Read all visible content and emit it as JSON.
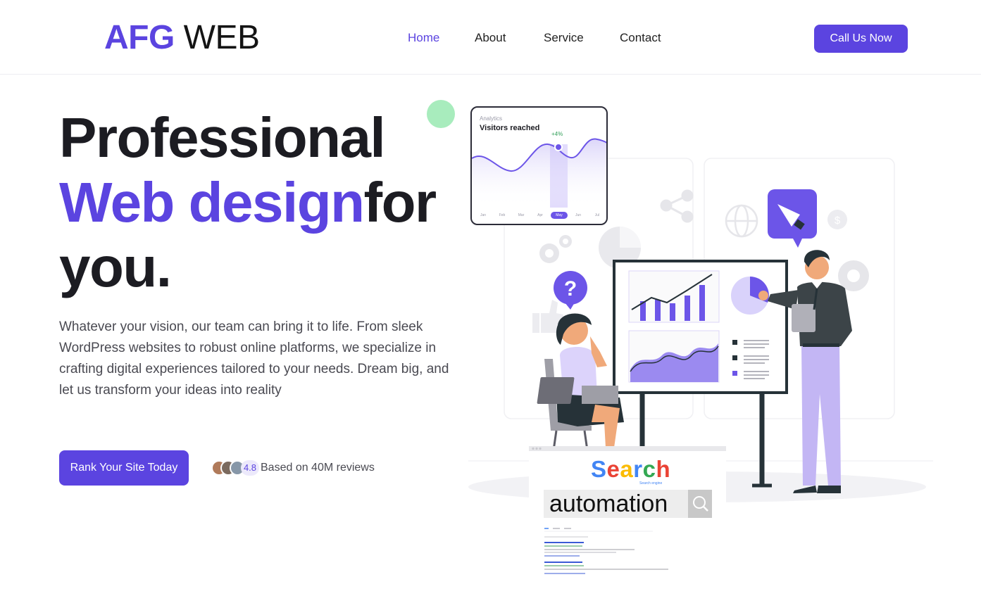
{
  "header": {
    "logo_bold": "AFG",
    "logo_light": "WEB",
    "nav": [
      {
        "label": "Home",
        "active": true
      },
      {
        "label": "About",
        "active": false
      },
      {
        "label": "Service",
        "active": false
      },
      {
        "label": "Contact",
        "active": false
      }
    ],
    "cta_label": "Call Us Now"
  },
  "hero": {
    "title_line1": "Professional",
    "title_accent": "Web design",
    "title_rest": "for",
    "title_line3": "you.",
    "description": "Whatever your vision, our team can bring it to life. From sleek WordPress websites to robust online platforms, we specialize in crafting digital experiences tailored to your needs. Dream big, and let us transform your ideas into reality",
    "button_label": "Rank Your Site Today",
    "rating": "4.8",
    "reviews_text": "Based on 40M reviews"
  },
  "analytics_card": {
    "subtitle": "Analytics",
    "title": "Visitors reached",
    "badge": "+4%",
    "months": [
      "Jan",
      "Feb",
      "Mar",
      "Apr",
      "May",
      "Jun",
      "Jul"
    ],
    "selected_month": "May"
  },
  "search_panel": {
    "logo": [
      "S",
      "e",
      "a",
      "r",
      "c",
      "h"
    ],
    "tagline": "Search engine",
    "query": "automation"
  },
  "colors": {
    "accent": "#5b44e0",
    "accent_light": "#b8acf4",
    "text_dark": "#1c1c22",
    "text_muted": "#4a4a52"
  },
  "icons": [
    "question-icon",
    "megaphone-icon",
    "search-icon",
    "gear-icon",
    "globe-icon",
    "share-icon",
    "dollar-icon",
    "like-icon",
    "laptop-icon"
  ]
}
